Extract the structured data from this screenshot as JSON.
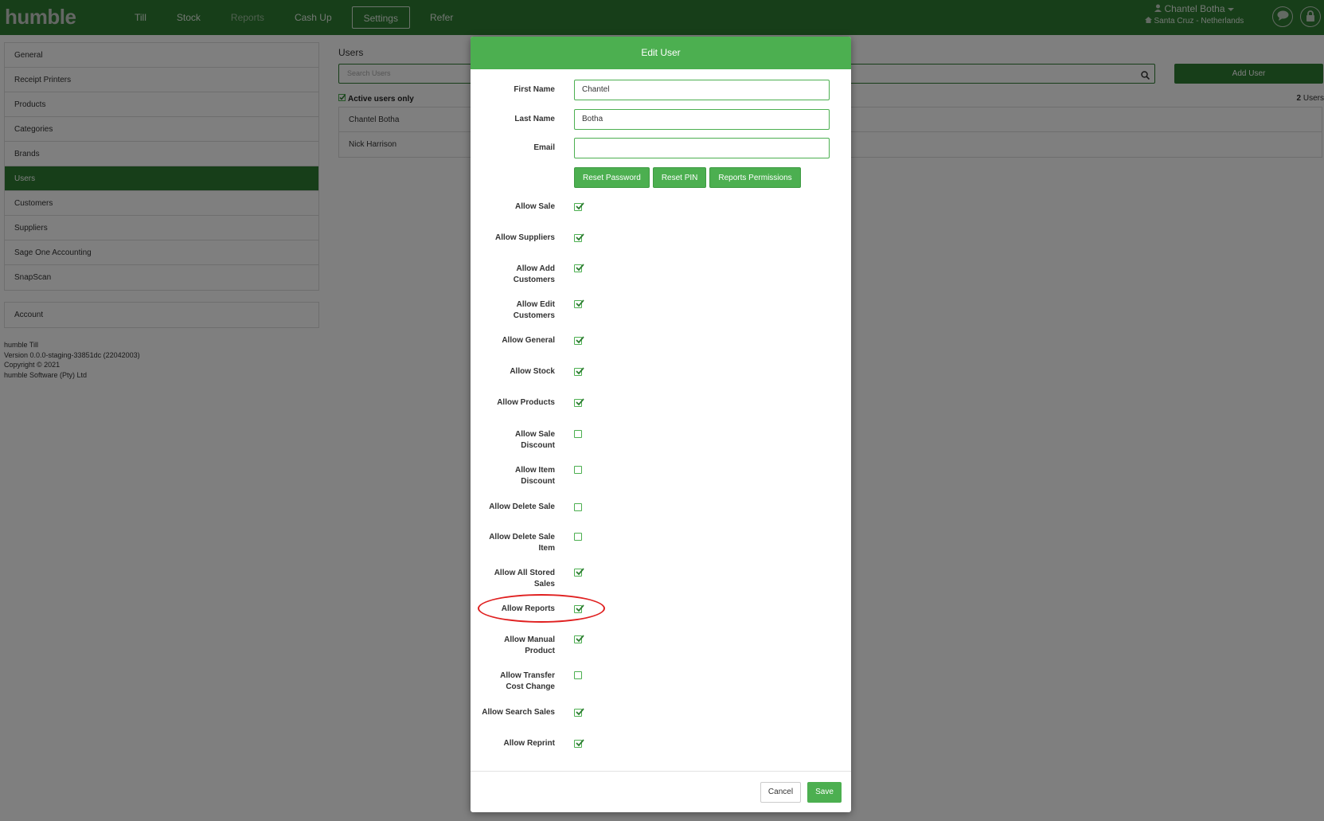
{
  "app": {
    "logo": "humble"
  },
  "nav": {
    "items": [
      {
        "label": "Till"
      },
      {
        "label": "Stock"
      },
      {
        "label": "Reports"
      },
      {
        "label": "Cash Up"
      },
      {
        "label": "Settings"
      },
      {
        "label": "Refer"
      }
    ],
    "active": "Settings"
  },
  "user": {
    "name": "Chantel Botha",
    "location": "Santa Cruz - Netherlands"
  },
  "sidebar": {
    "items": [
      {
        "label": "General"
      },
      {
        "label": "Receipt Printers"
      },
      {
        "label": "Products"
      },
      {
        "label": "Categories"
      },
      {
        "label": "Brands"
      },
      {
        "label": "Users"
      },
      {
        "label": "Customers"
      },
      {
        "label": "Suppliers"
      },
      {
        "label": "Sage One Accounting"
      },
      {
        "label": "SnapScan"
      }
    ],
    "active": "Users",
    "account_label": "Account"
  },
  "version_info": {
    "line1": "humble Till",
    "line2": "Version 0.0.0-staging-33851dc (22042003)",
    "line3": "Copyright © 2021",
    "line4": "humble Software (Pty) Ltd"
  },
  "users_page": {
    "title": "Users",
    "search_placeholder": "Search Users",
    "add_user_label": "Add User",
    "active_only_label": "Active users only",
    "count_number": "2",
    "count_suffix": "Users",
    "rows": [
      {
        "name": "Chantel Botha"
      },
      {
        "name": "Nick Harrison"
      }
    ]
  },
  "modal": {
    "title": "Edit User",
    "first_name_label": "First Name",
    "first_name_value": "Chantel",
    "last_name_label": "Last Name",
    "last_name_value": "Botha",
    "email_label": "Email",
    "email_value": "",
    "buttons": {
      "reset_password": "Reset Password",
      "reset_pin": "Reset PIN",
      "reports_permissions": "Reports Permissions"
    },
    "permissions": [
      {
        "line1": "Allow Sale",
        "line2": "",
        "checked": true
      },
      {
        "line1": "Allow Suppliers",
        "line2": "",
        "checked": true
      },
      {
        "line1": "Allow Add",
        "line2": "Customers",
        "checked": true
      },
      {
        "line1": "Allow Edit",
        "line2": "Customers",
        "checked": true
      },
      {
        "line1": "Allow General",
        "line2": "",
        "checked": true
      },
      {
        "line1": "Allow Stock",
        "line2": "",
        "checked": true
      },
      {
        "line1": "Allow Products",
        "line2": "",
        "checked": true
      },
      {
        "line1": "Allow Sale",
        "line2": "Discount",
        "checked": false
      },
      {
        "line1": "Allow Item",
        "line2": "Discount",
        "checked": false
      },
      {
        "line1": "Allow Delete Sale",
        "line2": "",
        "checked": false
      },
      {
        "line1": "Allow Delete Sale",
        "line2": "Item",
        "checked": false
      },
      {
        "line1": "Allow All Stored",
        "line2": "Sales",
        "checked": true
      },
      {
        "line1": "Allow Reports",
        "line2": "",
        "checked": true
      },
      {
        "line1": "Allow Manual",
        "line2": "Product",
        "checked": true
      },
      {
        "line1": "Allow Transfer",
        "line2": "Cost Change",
        "checked": false
      },
      {
        "line1": "Allow Search Sales",
        "line2": "",
        "checked": true
      },
      {
        "line1": "Allow Reprint",
        "line2": "",
        "checked": true
      }
    ],
    "cancel_label": "Cancel",
    "save_label": "Save"
  },
  "colors": {
    "brand_green": "#2e7d32",
    "accent_green": "#4caf50",
    "highlight_red": "#e02020"
  }
}
